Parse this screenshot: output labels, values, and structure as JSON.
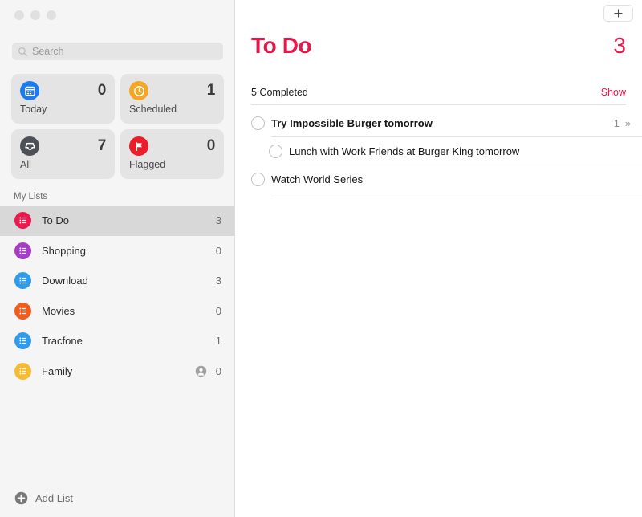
{
  "window": {
    "traffic_lights": [
      "close",
      "minimize",
      "zoom"
    ]
  },
  "colors": {
    "accent_red": "#e8174a",
    "sidebar_bg": "#f5f5f5",
    "selected_row": "#d8d8d8",
    "card_bg": "#e4e4e4"
  },
  "sidebar": {
    "search": {
      "placeholder": "Search",
      "value": "",
      "icon": "search-icon"
    },
    "smart_lists": [
      {
        "label": "Today",
        "count": "0",
        "icon": "calendar-icon",
        "color": "#1c7ced"
      },
      {
        "label": "Scheduled",
        "count": "1",
        "icon": "clock-icon",
        "color": "#f5a623"
      },
      {
        "label": "All",
        "count": "7",
        "icon": "tray-icon",
        "color": "#4c5057"
      },
      {
        "label": "Flagged",
        "count": "0",
        "icon": "flag-icon",
        "color": "#ed1c2a"
      }
    ],
    "section_title": "My Lists",
    "lists": [
      {
        "name": "To Do",
        "count": "3",
        "color": "#ea1a4e",
        "icon": "list-icon",
        "selected": true,
        "shared": false
      },
      {
        "name": "Shopping",
        "count": "0",
        "color": "#a63ec5",
        "icon": "list-icon",
        "selected": false,
        "shared": false
      },
      {
        "name": "Download",
        "count": "3",
        "color": "#2f9bea",
        "icon": "list-icon",
        "selected": false,
        "shared": false
      },
      {
        "name": "Movies",
        "count": "0",
        "color": "#f05b1e",
        "icon": "list-icon",
        "selected": false,
        "shared": false
      },
      {
        "name": "Tracfone",
        "count": "1",
        "color": "#2f9bea",
        "icon": "list-icon",
        "selected": false,
        "shared": false
      },
      {
        "name": "Family",
        "count": "0",
        "color": "#f5bc33",
        "icon": "list-icon",
        "selected": false,
        "shared": true
      }
    ],
    "add_list": {
      "label": "Add List",
      "icon": "plus-circle-icon"
    }
  },
  "main": {
    "add_button_icon": "plus-icon",
    "title": "To Do",
    "count": "3",
    "completed_label": "5 Completed",
    "show_label": "Show",
    "reminders": [
      {
        "text": "Try Impossible Burger tomorrow",
        "bold": true,
        "sub": false,
        "meta_count": "1",
        "meta_chevron": "»",
        "checked": false
      },
      {
        "text": "Lunch with Work Friends at Burger King tomorrow",
        "bold": false,
        "sub": true,
        "meta_count": "",
        "meta_chevron": "",
        "checked": false
      },
      {
        "text": "Watch World Series",
        "bold": false,
        "sub": false,
        "meta_count": "",
        "meta_chevron": "",
        "checked": false
      }
    ]
  }
}
